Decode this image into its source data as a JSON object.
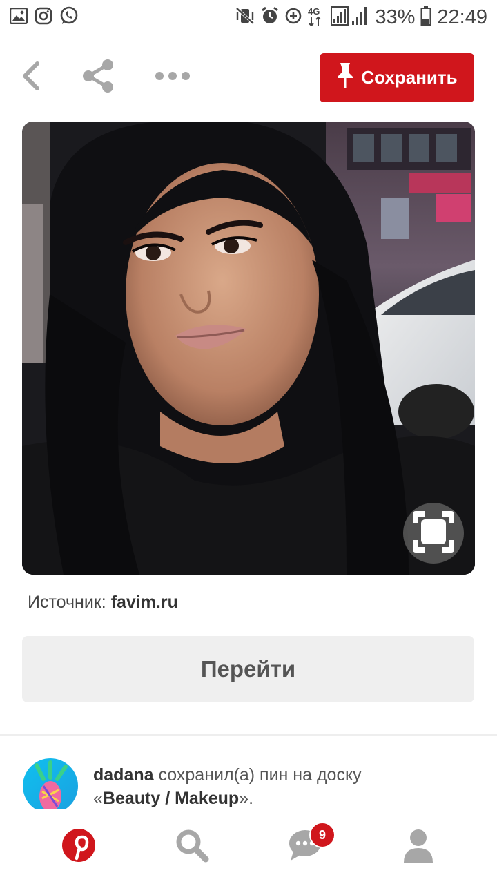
{
  "status_bar": {
    "left_icons": [
      "gallery-icon",
      "instagram-icon",
      "whatsapp-icon"
    ],
    "right_icons": [
      "vibrate-mute-icon",
      "alarm-icon",
      "data-saver-icon",
      "4g-signal-icon",
      "signal-icon"
    ],
    "battery": "33%",
    "time": "22:49"
  },
  "toolbar": {
    "back_icon": "chevron-left-icon",
    "share_icon": "share-icon",
    "more_icon": "more-dots-icon",
    "save_label": "Сохранить",
    "save_icon": "pin-icon"
  },
  "pin": {
    "zoom_icon": "visual-search-icon",
    "source_label": "Источник:",
    "source_domain": "favim.ru",
    "go_label": "Перейти"
  },
  "activity": {
    "username": "dadana",
    "action": " сохранил(а) пин на доску",
    "board_prefix": "«",
    "board": "Beauty / Makeup",
    "board_suffix": "»."
  },
  "bottom_nav": {
    "items": [
      "pinterest-home-icon",
      "search-icon",
      "messages-icon",
      "profile-icon"
    ],
    "messages_badge": "9"
  },
  "colors": {
    "brand_red": "#d0161c",
    "button_gray": "#efefef",
    "icon_gray": "#a7a7a7"
  }
}
